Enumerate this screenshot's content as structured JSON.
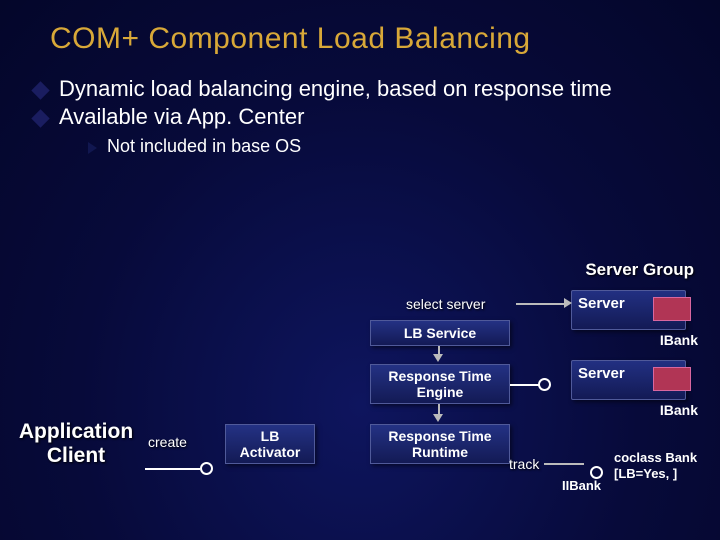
{
  "title": "COM+ Component Load Balancing",
  "bullets": {
    "b1": "Dynamic load balancing engine, based on response time",
    "b2": "Available via App. Center",
    "sub1": "Not included in base OS"
  },
  "diagram": {
    "serverGroup": "Server Group",
    "server1": "Server",
    "server2": "Server",
    "ibank1": "IBank",
    "ibank2": "IBank",
    "selectServer": "select server",
    "lbService": "LB Service",
    "respEngine1": "Response Time",
    "respEngine2": "Engine",
    "respRuntime1": "Response Time",
    "respRuntime2": "Runtime",
    "track": "track",
    "lbActivator1": "LB",
    "lbActivator2": "Activator",
    "create": "create",
    "appClient1": "Application",
    "appClient2": "Client",
    "coclass": "coclass Bank",
    "lbAttr": "[LB=Yes, ]",
    "iibank": "IIBank"
  }
}
